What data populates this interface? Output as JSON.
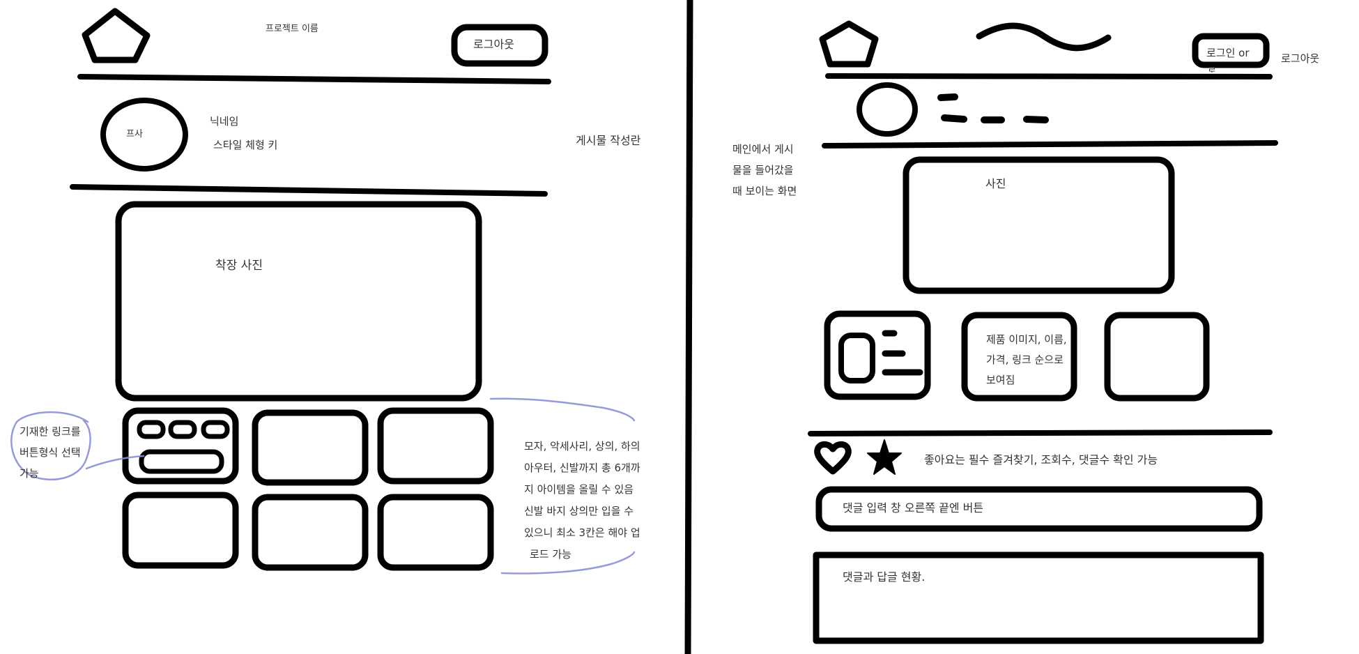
{
  "post_write_screen": {
    "project_name": "프로젝트 이름",
    "logout_button": "로그아웃",
    "profile_photo": "프사",
    "nickname": "닉네임",
    "style_height": "스타일 체형 키",
    "side_label": "게시물 작성란",
    "outfit_photo": "착장 사진",
    "link_note_lines": [
      "기재한 링크를",
      "버튼형식 선택",
      "가능"
    ],
    "items_note_lines": [
      "모자, 악세사리, 상의, 하의",
      "아우터, 신발까지 총 6개까",
      "지 아이템을 올릴 수 있음",
      "신발 바지 상의만 입을 수",
      "있으니 최소 3칸은 해야 업",
      "로드 가능"
    ]
  },
  "post_view_screen": {
    "login_or": "로그인 or",
    "login_or_cut": "로",
    "logout_text": "로그아웃",
    "side_note_lines": [
      "메인에서 게시",
      "물을 들어갔을",
      "때 보이는 화면"
    ],
    "photo": "사진",
    "product_note_lines": [
      "제품 이미지, 이름,",
      "가격, 링크 순으로",
      "보여짐"
    ],
    "like_fav_note": "좋아요는 필수 즐겨찾기, 조회수, 댓글수 확인 가능",
    "comment_input": "댓글 입력 창 오른쪽 끝엔 버튼",
    "comment_status": "댓글과 답글 현황."
  },
  "colors": {
    "stroke": "#000000",
    "annotation": "#8a8fd6",
    "text": "#333333"
  },
  "icons": [
    "pentagon-logo-icon",
    "wave-icon",
    "heart-icon",
    "star-icon"
  ]
}
